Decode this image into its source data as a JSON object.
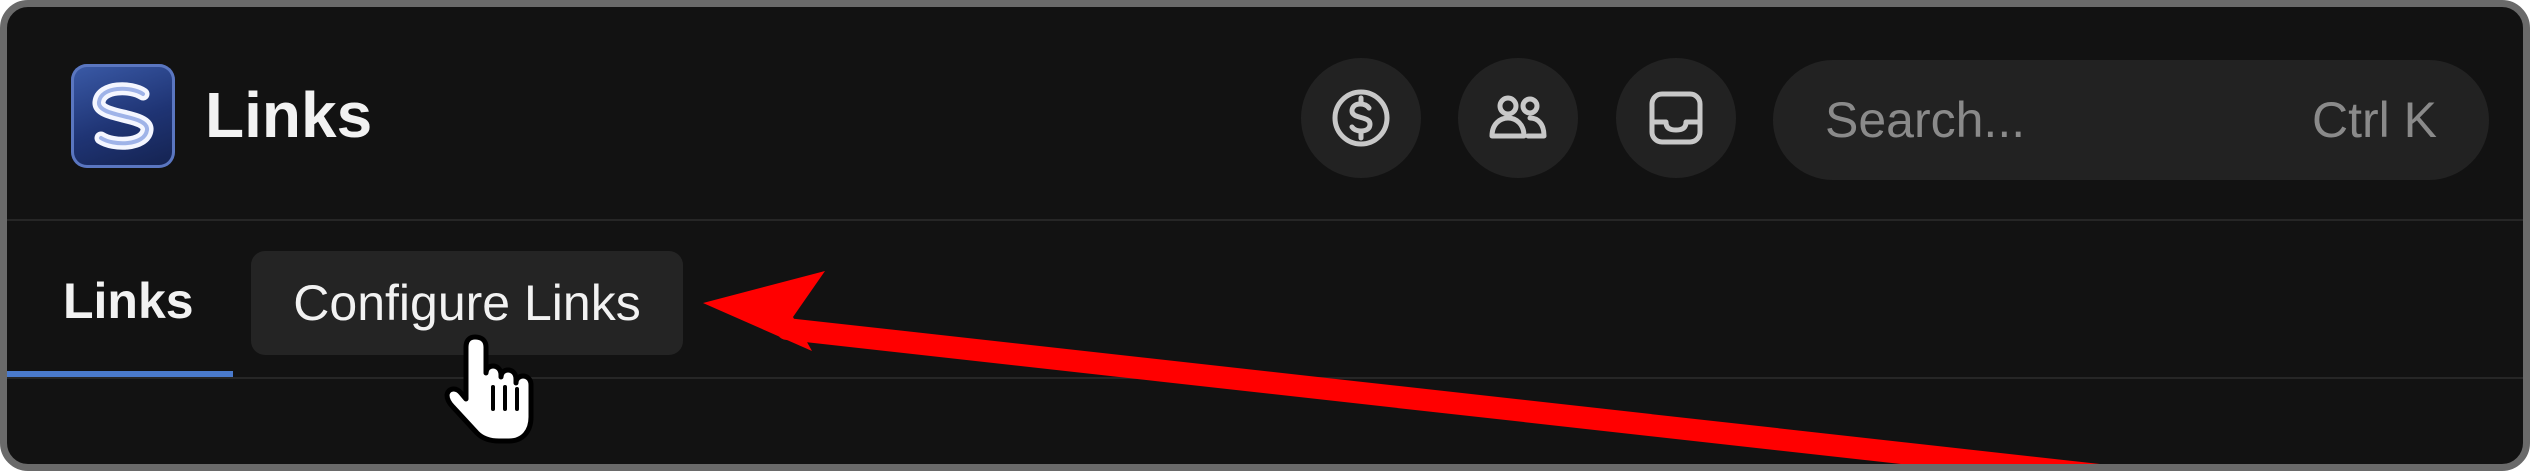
{
  "header": {
    "title": "Links",
    "logo_icon": "app-logo-icon",
    "buttons": [
      {
        "icon": "dollar-icon"
      },
      {
        "icon": "users-icon"
      },
      {
        "icon": "inbox-icon"
      }
    ],
    "search": {
      "placeholder": "Search...",
      "shortcut": "Ctrl K"
    }
  },
  "tabs": {
    "items": [
      {
        "label": "Links",
        "active": true
      },
      {
        "label": "Configure Links",
        "active": false
      }
    ],
    "accent_color": "#4a7acc"
  },
  "annotation": {
    "arrow_color": "#ff0000",
    "cursor_icon": "hand-pointer-icon"
  }
}
